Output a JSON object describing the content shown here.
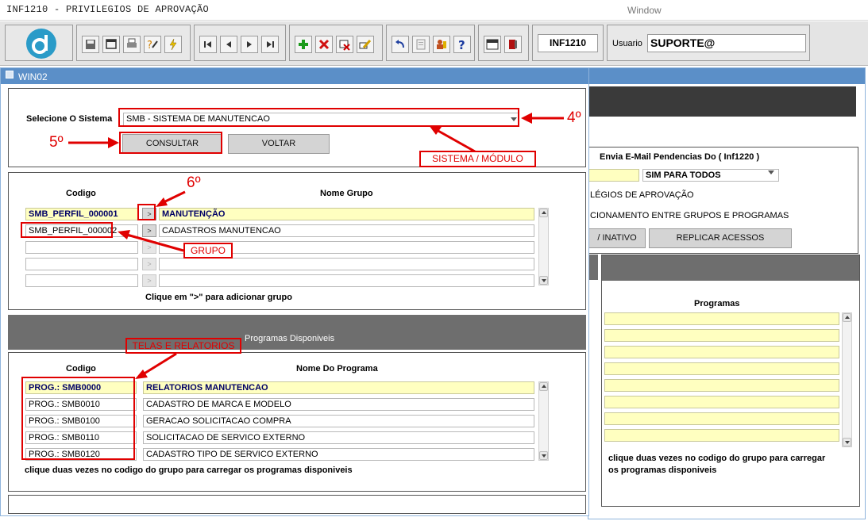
{
  "window": {
    "app_title": "INF1210 - PRIVILEGIOS DE APROVAÇÃO",
    "menu_title": "Window"
  },
  "toolbar": {
    "form_code": "INF1210",
    "user_label": "Usuario",
    "user_value": "SUPORTE@"
  },
  "win02": {
    "title": "WIN02"
  },
  "selection": {
    "system_label": "Selecione O Sistema",
    "system_value": "SMB - SISTEMA DE MANUTENCAO",
    "consultar": "CONSULTAR",
    "voltar": "VOLTAR"
  },
  "groups": {
    "col_code": "Codigo",
    "col_name": "Nome Grupo",
    "add_symbol": ">",
    "rows": [
      {
        "code": "SMB_PERFIL_000001",
        "name": "MANUTENÇÃO"
      },
      {
        "code": "SMB_PERFIL_000002",
        "name": "CADASTROS MANUTENCAO"
      },
      {
        "code": "",
        "name": ""
      },
      {
        "code": "",
        "name": ""
      },
      {
        "code": "",
        "name": ""
      }
    ],
    "hint": "Clique em \">\" para adicionar grupo"
  },
  "programs": {
    "section_title": "Programas Disponiveis",
    "col_code": "Codigo",
    "col_name": "Nome Do Programa",
    "rows": [
      {
        "code": "PROG.: SMB0000",
        "name": "RELATORIOS MANUTENCAO"
      },
      {
        "code": "PROG.: SMB0010",
        "name": "CADASTRO DE MARCA E MODELO"
      },
      {
        "code": "PROG.: SMB0100",
        "name": "GERACAO SOLICITACAO COMPRA"
      },
      {
        "code": "PROG.: SMB0110",
        "name": "SOLICITACAO DE SERVICO EXTERNO"
      },
      {
        "code": "PROG.: SMB0120",
        "name": "CADASTRO TIPO DE SERVICO EXTERNO"
      }
    ],
    "hint": "clique duas vezes no codigo do grupo para carregar os programas disponiveis"
  },
  "background": {
    "email_title": "Envia E-Mail Pendencias Do ( Inf1220 )",
    "email_value": "SIM PARA TODOS",
    "text1": "LÉGIOS DE APROVAÇÃO",
    "text2": "CIONAMENTO ENTRE GRUPOS E PROGRAMAS",
    "btn_inativo": "/ INATIVO",
    "btn_replicar": "REPLICAR ACESSOS",
    "programs_title": "Programas",
    "hint_line1": "clique duas vezes no codigo do grupo para carregar",
    "hint_line2": "os programas disponiveis"
  },
  "annotations": {
    "step4": "4º",
    "step5": "5º",
    "step6": "6º",
    "sistema_modulo": "SISTEMA / MÓDULO",
    "grupo": "GRUPO",
    "telas_relatorios": "TELAS E RELATORIOS"
  },
  "colors": {
    "annotation": "#e00000",
    "highlight": "#ffffc0",
    "title_bar": "#5b8fc8",
    "dark_band": "#6e6e6e"
  }
}
